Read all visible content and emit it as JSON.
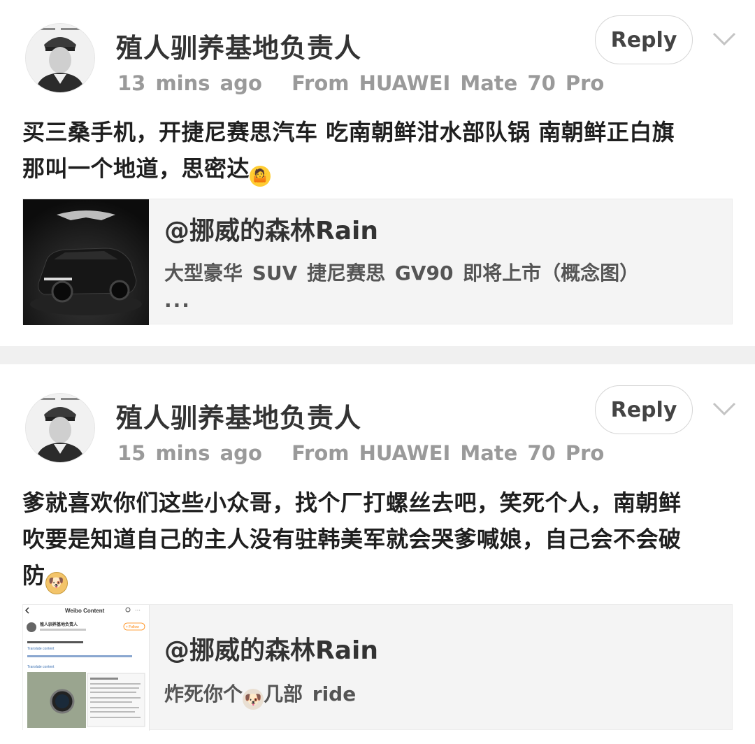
{
  "posts": [
    {
      "username": "殖人驯养基地负责人",
      "time": "13 mins ago",
      "source": "From HUAWEI Mate 70 Pro",
      "reply_label": "Reply",
      "text_line1": "买三桑手机，开捷尼赛思汽车 吃南朝鲜泔水部队锅  南朝鲜正白旗",
      "text_line2": "那叫一个地道，思密达",
      "emoji": "shrug-emoji",
      "card": {
        "title": "@挪威的森林Rain",
        "subtitle": "大型豪华 SUV 捷尼赛思 GV90 即将上市（概念图）",
        "more": "..."
      }
    },
    {
      "username": "殖人驯养基地负责人",
      "time": "15 mins ago",
      "source": "From HUAWEI Mate 70 Pro",
      "reply_label": "Reply",
      "text_line1": "爹就喜欢你们这些小众哥，找个厂打螺丝去吧，笑死个人，南朝鲜",
      "text_line2": "吹要是知道自己的主人没有驻韩美军就会哭爹喊娘，自己会不会破",
      "text_line3": "防",
      "emoji": "doge-emoji",
      "card": {
        "title": "@挪威的森林Rain",
        "subtitle_pre": "炸死你个",
        "subtitle_post": "几部 ride",
        "thumb_header": "Weibo Content",
        "thumb_name": "殖人驯养基地负责人",
        "thumb_follow": "+ Follow",
        "thumb_translate": "Translate content"
      }
    }
  ],
  "colors": {
    "meta": "#9a9a9a",
    "card_bg": "#f4f4f4",
    "separator": "#f0f0f0"
  }
}
